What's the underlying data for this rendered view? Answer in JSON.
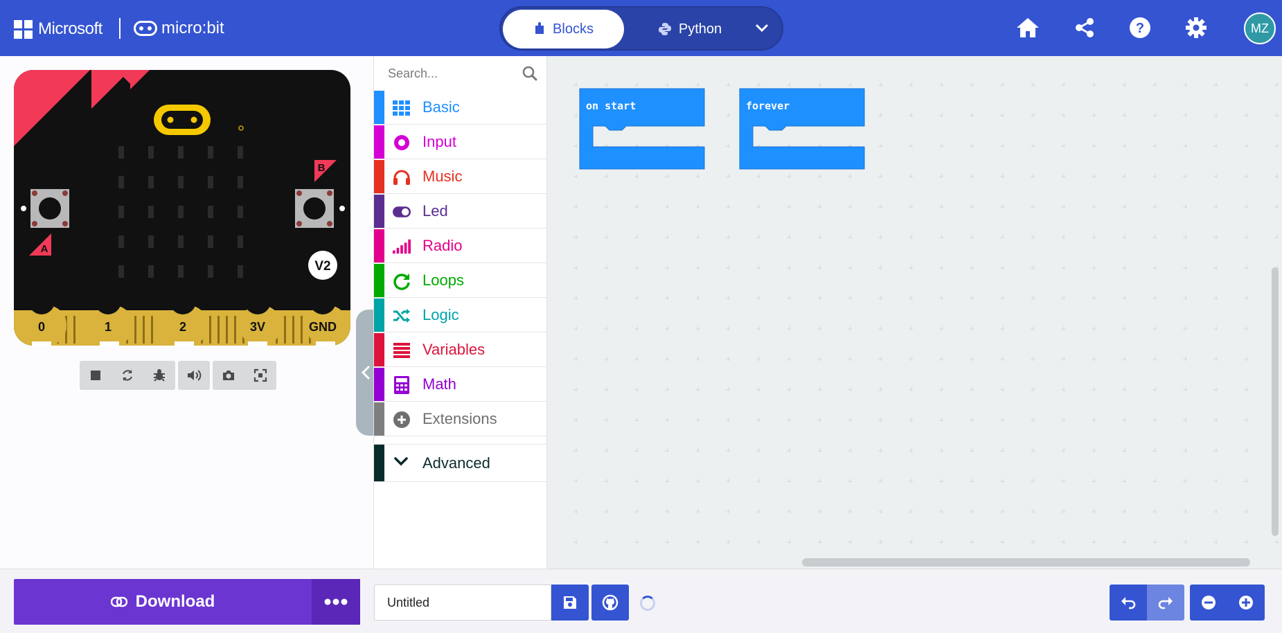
{
  "header": {
    "brand": "Microsoft",
    "product": "micro:bit",
    "modes": {
      "blocks": "Blocks",
      "python": "Python",
      "active": "Blocks"
    },
    "icons": [
      "home-icon",
      "share-icon",
      "help-icon",
      "settings-icon"
    ],
    "avatar_initials": "MZ",
    "bg_color": "#3454d1"
  },
  "simulator": {
    "board_labels": {
      "button_a": "A",
      "button_b": "B",
      "version": "V2"
    },
    "pins": [
      "0",
      "1",
      "2",
      "3V",
      "GND"
    ],
    "toolbar_icons": [
      "stop-icon",
      "restart-icon",
      "debug-icon",
      "mute-icon",
      "screenshot-icon",
      "fullscreen-icon"
    ]
  },
  "toolbox": {
    "search_placeholder": "Search...",
    "categories": [
      {
        "label": "Basic",
        "color": "#1e90ff",
        "icon": "grid-icon"
      },
      {
        "label": "Input",
        "color": "#d400d4",
        "icon": "radio-button-icon"
      },
      {
        "label": "Music",
        "color": "#e63022",
        "icon": "headphones-icon"
      },
      {
        "label": "Led",
        "color": "#5c2d91",
        "icon": "toggle-icon"
      },
      {
        "label": "Radio",
        "color": "#e3008c",
        "icon": "signal-bars-icon"
      },
      {
        "label": "Loops",
        "color": "#00aa00",
        "icon": "refresh-icon"
      },
      {
        "label": "Logic",
        "color": "#00a4a6",
        "icon": "shuffle-icon"
      },
      {
        "label": "Variables",
        "color": "#dc143c",
        "icon": "list-lines-icon"
      },
      {
        "label": "Math",
        "color": "#9400d3",
        "icon": "calculator-icon"
      },
      {
        "label": "Extensions",
        "color": "#7f7f7f",
        "icon": "plus-circle-icon"
      }
    ],
    "advanced_label": "Advanced"
  },
  "workspace": {
    "blocks": [
      {
        "label": "on start",
        "color": "#1e90ff"
      },
      {
        "label": "forever",
        "color": "#1e90ff"
      }
    ]
  },
  "footer": {
    "download_label": "Download",
    "project_name": "Untitled",
    "accent_color": "#6b35d1"
  }
}
